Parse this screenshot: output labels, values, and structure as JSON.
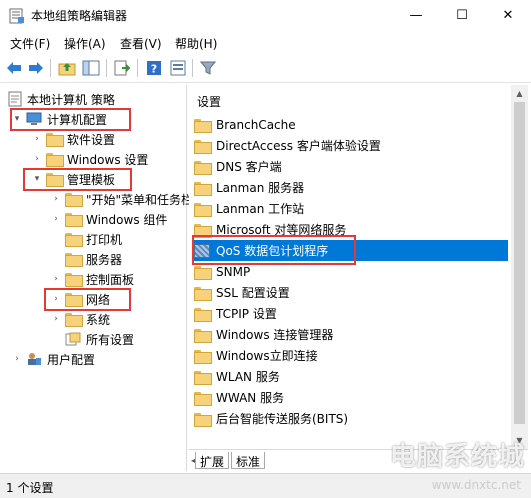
{
  "window": {
    "title": "本地组策略编辑器",
    "min_glyph": "—",
    "max_glyph": "☐",
    "close_glyph": "✕"
  },
  "menu": [
    "文件(F)",
    "操作(A)",
    "查看(V)",
    "帮助(H)"
  ],
  "tree": {
    "root": "本地计算机 策略",
    "items": [
      {
        "label": "计算机配置",
        "level": 1,
        "expanded": true,
        "highlighted": true
      },
      {
        "label": "软件设置",
        "level": 2
      },
      {
        "label": "Windows 设置",
        "level": 2
      },
      {
        "label": "管理模板",
        "level": 2,
        "expanded": true,
        "highlighted": true
      },
      {
        "label": "\"开始\"菜单和任务栏",
        "level": 3
      },
      {
        "label": "Windows 组件",
        "level": 3
      },
      {
        "label": "打印机",
        "level": 3
      },
      {
        "label": "服务器",
        "level": 3
      },
      {
        "label": "控制面板",
        "level": 3
      },
      {
        "label": "网络",
        "level": 3,
        "highlighted": true
      },
      {
        "label": "系统",
        "level": 3
      },
      {
        "label": "所有设置",
        "level": 3
      },
      {
        "label": "用户配置",
        "level": 1
      }
    ]
  },
  "list": {
    "header": "设置",
    "items": [
      "BranchCache",
      "DirectAccess 客户端体验设置",
      "DNS 客户端",
      "Lanman 服务器",
      "Lanman 工作站",
      "Microsoft 对等网络服务",
      "QoS 数据包计划程序",
      "SNMP",
      "SSL 配置设置",
      "TCPIP 设置",
      "Windows 连接管理器",
      "Windows立即连接",
      "WLAN 服务",
      "WWAN 服务",
      "后台智能传送服务(BITS)"
    ],
    "selected": "QoS 数据包计划程序"
  },
  "tabs": [
    "扩展",
    "标准"
  ],
  "status": "1 个设置",
  "watermark": "电脑系统城",
  "watermark_url": "www.dnxtc.net",
  "colors": {
    "selection": "#0078d7",
    "highlight_box": "#e53935"
  }
}
